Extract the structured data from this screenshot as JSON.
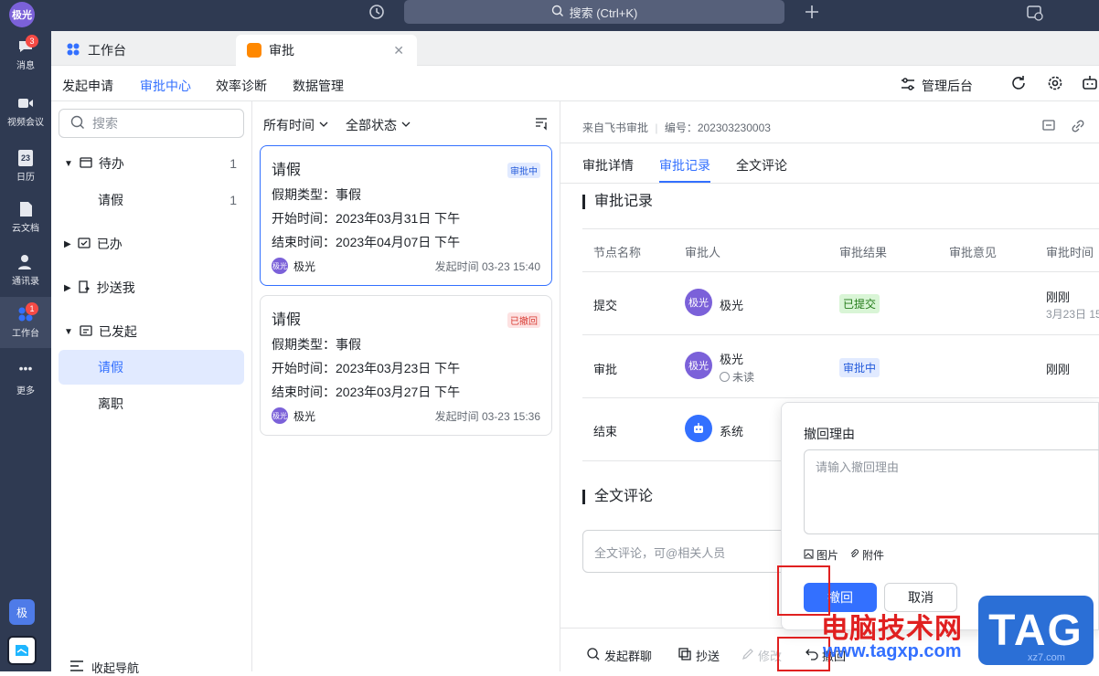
{
  "topbar": {
    "avatar": "极光",
    "search_label": "搜索 (Ctrl+K)",
    "history_icon": "clock-icon",
    "plus_icon": "plus-icon",
    "help_icon": "help-icon"
  },
  "rail": {
    "items": [
      {
        "label": "消息",
        "badge": "3",
        "icon": "message-icon"
      },
      {
        "label": "视频会议",
        "icon": "video-icon"
      },
      {
        "label": "日历",
        "icon": "calendar-icon",
        "icon_text": "23"
      },
      {
        "label": "云文档",
        "icon": "doc-icon"
      },
      {
        "label": "通讯录",
        "icon": "contacts-icon"
      },
      {
        "label": "工作台",
        "badge": "1",
        "icon": "workspace-icon"
      },
      {
        "label": "更多",
        "icon": "more-icon"
      }
    ],
    "bottom_avatar": "极"
  },
  "tabs": [
    {
      "label": "工作台",
      "icon": "workspace-icon"
    },
    {
      "label": "审批",
      "icon": "approval-icon"
    }
  ],
  "nav2": {
    "items": [
      "发起申请",
      "审批中心",
      "效率诊断",
      "数据管理"
    ],
    "admin": "管理后台"
  },
  "sidebar": {
    "search_placeholder": "搜索",
    "groups": [
      {
        "label": "待办",
        "count": "1"
      },
      {
        "label": "请假",
        "count": "1"
      },
      {
        "label": "已办"
      },
      {
        "label": "抄送我"
      },
      {
        "label": "已发起"
      },
      {
        "label": "请假"
      },
      {
        "label": "离职"
      }
    ],
    "collapse": "收起导航"
  },
  "list": {
    "filter_time": "所有时间",
    "filter_status": "全部状态",
    "cards": [
      {
        "title": "请假",
        "status": "审批中",
        "type_label": "假期类型：",
        "type_value": "事假",
        "start_label": "开始时间：",
        "start_value": "2023年03月31日 下午",
        "end_label": "结束时间：",
        "end_value": "2023年04月07日 下午",
        "user_avatar": "极光",
        "user": "极光",
        "time": "发起时间 03-23 15:40"
      },
      {
        "title": "请假",
        "status": "已撤回",
        "type_label": "假期类型：",
        "type_value": "事假",
        "start_label": "开始时间：",
        "start_value": "2023年03月23日 下午",
        "end_label": "结束时间：",
        "end_value": "2023年03月27日 下午",
        "user_avatar": "极光",
        "user": "极光",
        "time": "发起时间 03-23 15:36"
      }
    ]
  },
  "detail": {
    "source": "来自飞书审批",
    "number": "编号：202303230003",
    "tabs": [
      "审批详情",
      "审批记录",
      "全文评论"
    ],
    "record_title": "审批记录",
    "headers": [
      "节点名称",
      "审批人",
      "审批结果",
      "审批意见",
      "审批时间"
    ],
    "rows": [
      {
        "node": "提交",
        "avatar": "极光",
        "name": "极光",
        "result": "已提交",
        "time": "刚刚",
        "time2": "3月23日 15"
      },
      {
        "node": "审批",
        "avatar": "极光",
        "name": "极光",
        "sub": "未读",
        "result": "审批中",
        "time": "刚刚"
      },
      {
        "node": "结束",
        "name": "系统"
      }
    ],
    "comment_title": "全文评论",
    "comment_placeholder": "全文评论，可@相关人员",
    "bottom": [
      "发起群聊",
      "抄送",
      "修改",
      "撤回"
    ]
  },
  "popup": {
    "title": "撤回理由",
    "placeholder": "请输入撤回理由",
    "image": "图片",
    "attach": "附件",
    "confirm": "撤回",
    "cancel": "取消"
  },
  "watermark": {
    "line1": "电脑技术网",
    "url": "www.tagxp.com",
    "tag": "TAG",
    "small": "xz7.com"
  },
  "colors": {
    "accent": "#3370ff",
    "rail": "#2f3a52",
    "danger": "#e02020"
  }
}
